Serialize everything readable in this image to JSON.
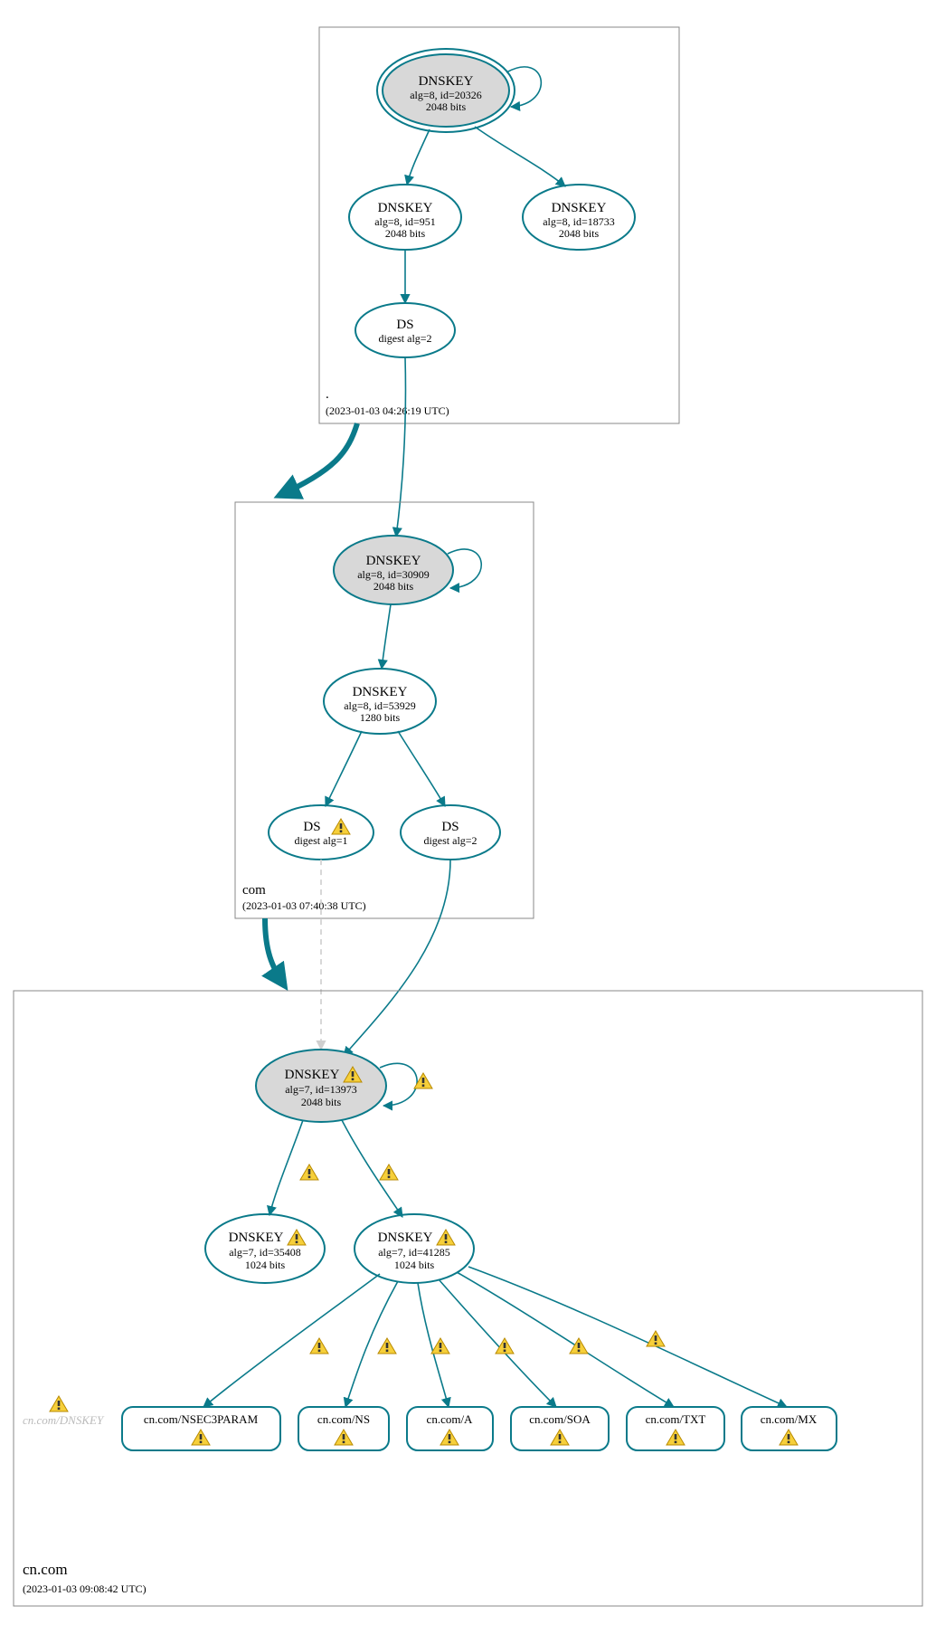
{
  "colors": {
    "stroke": "#0a7a8a",
    "fill_ksk": "#d8d8d8",
    "edge": "#0a7a8a",
    "zone_border": "#888",
    "faded": "#bfbfbf"
  },
  "zones": [
    {
      "name": ".",
      "timestamp": "(2023-01-03 04:26:19 UTC)",
      "nodes": [
        {
          "id": "root-ksk",
          "type": "DNSKEY",
          "title": "DNSKEY",
          "line1": "alg=8, id=20326",
          "line2": "2048 bits",
          "ksk": true,
          "doubleRing": true,
          "warn": false,
          "selfLoop": true
        },
        {
          "id": "root-zsk-951",
          "type": "DNSKEY",
          "title": "DNSKEY",
          "line1": "alg=8, id=951",
          "line2": "2048 bits",
          "ksk": false,
          "doubleRing": false,
          "warn": false
        },
        {
          "id": "root-zsk-18733",
          "type": "DNSKEY",
          "title": "DNSKEY",
          "line1": "alg=8, id=18733",
          "line2": "2048 bits",
          "ksk": false,
          "doubleRing": false,
          "warn": false
        },
        {
          "id": "root-ds",
          "type": "DS",
          "title": "DS",
          "line1": "digest alg=2",
          "line2": "",
          "ksk": false,
          "doubleRing": false,
          "warn": false
        }
      ],
      "edges": [
        {
          "from": "root-ksk",
          "to": "root-zsk-951"
        },
        {
          "from": "root-ksk",
          "to": "root-zsk-18733"
        },
        {
          "from": "root-zsk-951",
          "to": "root-ds"
        }
      ]
    },
    {
      "name": "com",
      "timestamp": "(2023-01-03 07:40:38 UTC)",
      "nodes": [
        {
          "id": "com-ksk",
          "type": "DNSKEY",
          "title": "DNSKEY",
          "line1": "alg=8, id=30909",
          "line2": "2048 bits",
          "ksk": true,
          "doubleRing": false,
          "warn": false,
          "selfLoop": true
        },
        {
          "id": "com-zsk",
          "type": "DNSKEY",
          "title": "DNSKEY",
          "line1": "alg=8, id=53929",
          "line2": "1280 bits",
          "ksk": false,
          "doubleRing": false,
          "warn": false
        },
        {
          "id": "com-ds1",
          "type": "DS",
          "title": "DS",
          "line1": "digest alg=1",
          "line2": "",
          "ksk": false,
          "doubleRing": false,
          "warn": true
        },
        {
          "id": "com-ds2",
          "type": "DS",
          "title": "DS",
          "line1": "digest alg=2",
          "line2": "",
          "ksk": false,
          "doubleRing": false,
          "warn": false
        }
      ],
      "edges": [
        {
          "from": "com-ksk",
          "to": "com-zsk"
        },
        {
          "from": "com-zsk",
          "to": "com-ds1"
        },
        {
          "from": "com-zsk",
          "to": "com-ds2"
        }
      ]
    },
    {
      "name": "cn.com",
      "timestamp": "(2023-01-03 09:08:42 UTC)",
      "nodes": [
        {
          "id": "cn-ksk",
          "type": "DNSKEY",
          "title": "DNSKEY",
          "line1": "alg=7, id=13973",
          "line2": "2048 bits",
          "ksk": true,
          "doubleRing": false,
          "warn": true,
          "selfLoop": true,
          "selfLoopWarn": true
        },
        {
          "id": "cn-zsk-35408",
          "type": "DNSKEY",
          "title": "DNSKEY",
          "line1": "alg=7, id=35408",
          "line2": "1024 bits",
          "ksk": false,
          "doubleRing": false,
          "warn": true
        },
        {
          "id": "cn-zsk",
          "type": "DNSKEY",
          "title": "DNSKEY",
          "line1": "alg=7, id=41285",
          "line2": "1024 bits",
          "ksk": false,
          "doubleRing": false,
          "warn": true
        }
      ],
      "rrsets": [
        {
          "id": "rr-nsec3",
          "label": "cn.com/NSEC3PARAM",
          "warn": true
        },
        {
          "id": "rr-ns",
          "label": "cn.com/NS",
          "warn": true
        },
        {
          "id": "rr-a",
          "label": "cn.com/A",
          "warn": true
        },
        {
          "id": "rr-soa",
          "label": "cn.com/SOA",
          "warn": true
        },
        {
          "id": "rr-txt",
          "label": "cn.com/TXT",
          "warn": true
        },
        {
          "id": "rr-mx",
          "label": "cn.com/MX",
          "warn": true
        }
      ],
      "detachedLabel": "cn.com/DNSKEY",
      "edges": [
        {
          "from": "cn-ksk",
          "to": "cn-zsk-35408",
          "warn": true
        },
        {
          "from": "cn-ksk",
          "to": "cn-zsk",
          "warn": true
        },
        {
          "from": "cn-zsk",
          "to": "rr-nsec3",
          "warn": true
        },
        {
          "from": "cn-zsk",
          "to": "rr-ns",
          "warn": true
        },
        {
          "from": "cn-zsk",
          "to": "rr-a",
          "warn": true
        },
        {
          "from": "cn-zsk",
          "to": "rr-soa",
          "warn": true
        },
        {
          "from": "cn-zsk",
          "to": "rr-txt",
          "warn": true
        },
        {
          "from": "cn-zsk",
          "to": "rr-mx",
          "warn": true
        }
      ]
    }
  ],
  "delegations": [
    {
      "from": "root-ds",
      "to": "com-ksk",
      "style": "solid"
    },
    {
      "from": "com-ds1",
      "to": "cn-ksk",
      "style": "dashed"
    },
    {
      "from": "com-ds2",
      "to": "cn-ksk",
      "style": "solid"
    }
  ],
  "zoneArrows": [
    {
      "from": "zone-root",
      "to": "zone-com"
    },
    {
      "from": "zone-com",
      "to": "zone-cn"
    }
  ]
}
